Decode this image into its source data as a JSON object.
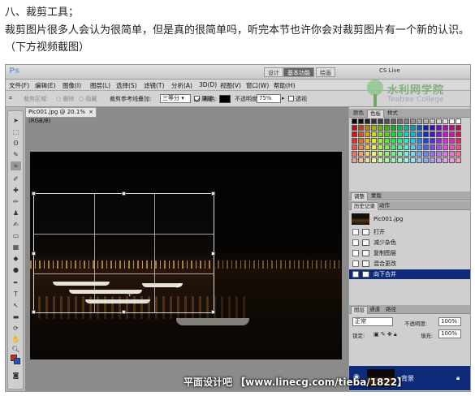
{
  "article": {
    "heading": "八、裁剪工具；",
    "intro": "裁剪图片很多人会认为很简单，但是真的很简单吗，听完本节也许你会对裁剪图片有一个新的认识。（下方视频截图）"
  },
  "app": {
    "logo": "Ps",
    "workspaces": [
      "设计",
      "基本功能",
      "绘画"
    ],
    "cs_live": "CS Live",
    "menus": [
      "文件(F)",
      "编辑(E)",
      "图像(I)",
      "图层(L)",
      "选择(S)",
      "滤镜(T)",
      "分析(A)",
      "3D(D)",
      "视图(V)",
      "窗口(W)",
      "帮助(H)"
    ]
  },
  "options": {
    "crop_area": "裁剪区域:",
    "delete": "删除",
    "hide": "隐藏",
    "overlay_label": "裁剪参考线叠加:",
    "overlay_value": "三等分",
    "shield_label": "屏蔽",
    "color_label": "颜色:",
    "opacity_label": "不透明度:",
    "opacity_value": "75%",
    "perspective_label": "透视"
  },
  "watermark_logo": {
    "name": "水利网学院",
    "sub": "Teatree College"
  },
  "document": {
    "tab_title": "Pic001.jpg @ 20.1%(RGB/8)"
  },
  "panels": {
    "swatches_tabs": [
      "颜色",
      "色板",
      "样式"
    ],
    "adjust_tabs": [
      "调整",
      "蒙版"
    ],
    "history_tabs": [
      "历史记录",
      "动作"
    ],
    "history_snapshot": "Pic001.jpg",
    "history_items": [
      "打开",
      "减少杂色",
      "复制图层",
      "混合更改",
      "向下合并"
    ],
    "layers_tabs": [
      "图层",
      "通道",
      "路径"
    ],
    "blend_mode": "正常",
    "layer_opacity_label": "不透明度:",
    "layer_opacity_value": "100%",
    "lock_label": "锁定:",
    "fill_label": "填充:",
    "fill_value": "100%",
    "layer_name": "背景"
  },
  "footer": {
    "watermark": "平面设计吧 【www.linecg.com/tieba/1822】"
  },
  "colors": {
    "accent": "#0e2a7a",
    "fg": "#d62b1a",
    "bg": "#2a51c3"
  }
}
